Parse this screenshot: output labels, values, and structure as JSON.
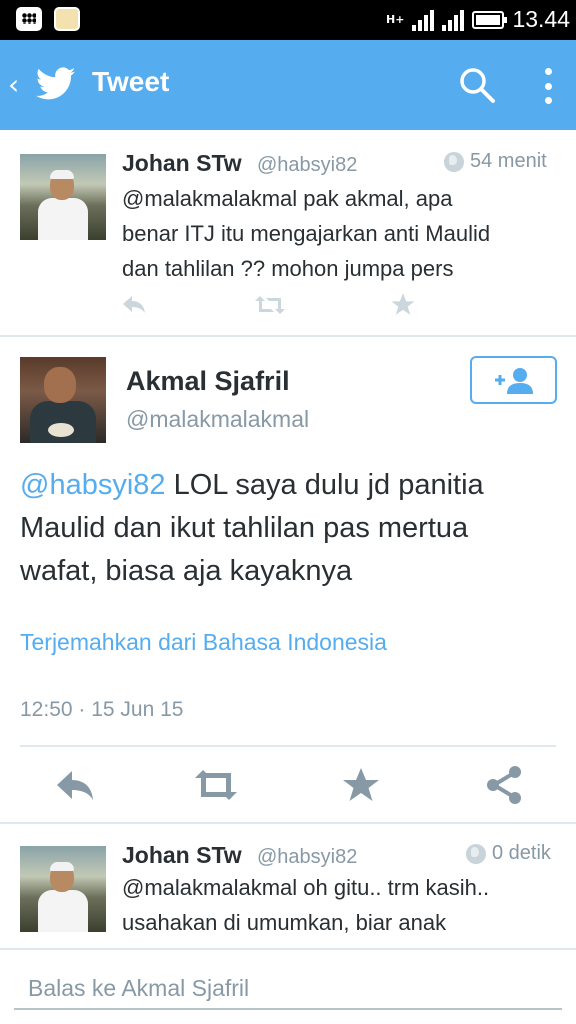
{
  "status_bar": {
    "time": "13.44",
    "network": "H+",
    "icons": [
      "bbm-icon",
      "notes-icon"
    ]
  },
  "app_bar": {
    "title": "Tweet",
    "back": "‹"
  },
  "tweets_above": [
    {
      "name": "Johan STw",
      "handle": "@habsyi82",
      "time": "54 menit",
      "text_lines": [
        "@malakmalakmal pak akmal, apa",
        "benar ITJ itu mengajarkan anti Maulid",
        "dan tahlilan ?? mohon jumpa pers"
      ]
    }
  ],
  "main_tweet": {
    "name": "Akmal Sjafril",
    "handle": "@malakmalakmal",
    "mention": "@habsyi82",
    "text_line1_rest": " LOL saya dulu jd panitia",
    "text_line2": "Maulid dan ikut tahlilan pas mertua",
    "text_line3": "wafat, biasa aja kayaknya",
    "translate": "Terjemahkan dari Bahasa Indonesia",
    "timestamp": "12:50 · 15 Jun 15",
    "follow_label": "+👤"
  },
  "tweets_below": [
    {
      "name": "Johan STw",
      "handle": "@habsyi82",
      "time": "0 detik",
      "text_lines": [
        "@malakmalakmal oh gitu.. trm kasih..",
        "usahakan di umumkan, biar anak"
      ]
    }
  ],
  "reply": {
    "placeholder": "Balas ke Akmal Sjafril"
  },
  "colors": {
    "brand": "#55acee",
    "muted": "#8899a6",
    "text": "#292f33",
    "action_inactive": "#ccd6dd",
    "action_active": "#8899a6"
  }
}
